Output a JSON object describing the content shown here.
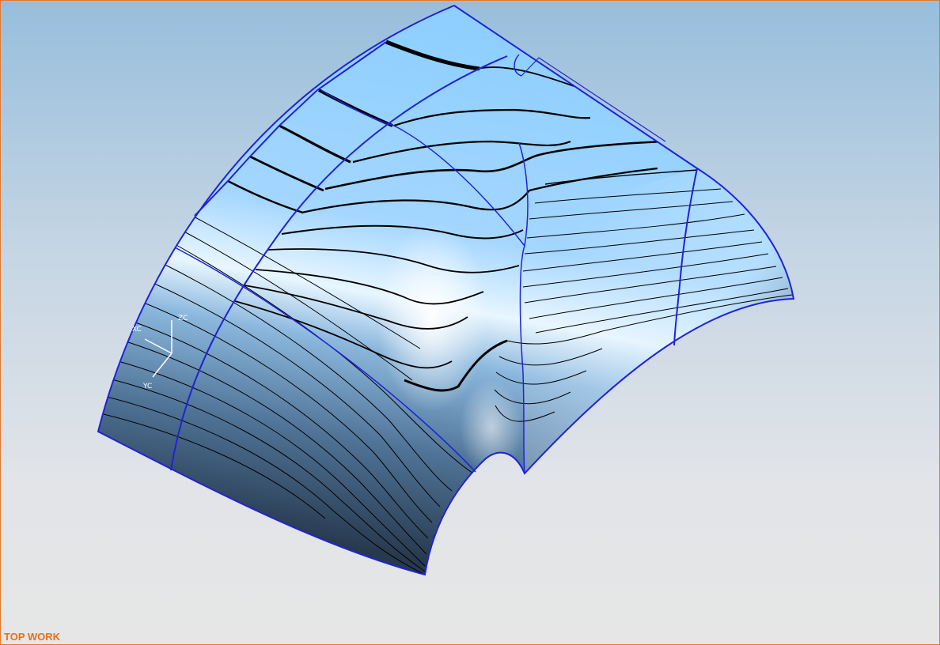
{
  "viewport": {
    "view_name": "TOP WORK",
    "background_top": "#97bedc",
    "background_bottom": "#e6e6e6",
    "border_color": "#e07a2e"
  },
  "model": {
    "surface_color": "#7fc4ff",
    "surface_shadow": "#2d465e",
    "edge_color": "#1f23d6",
    "contour_color": "#000000"
  },
  "triad": {
    "label_x": "XC",
    "label_y": "YC",
    "label_z": "ZC",
    "icon": "wcs-triad-icon"
  }
}
